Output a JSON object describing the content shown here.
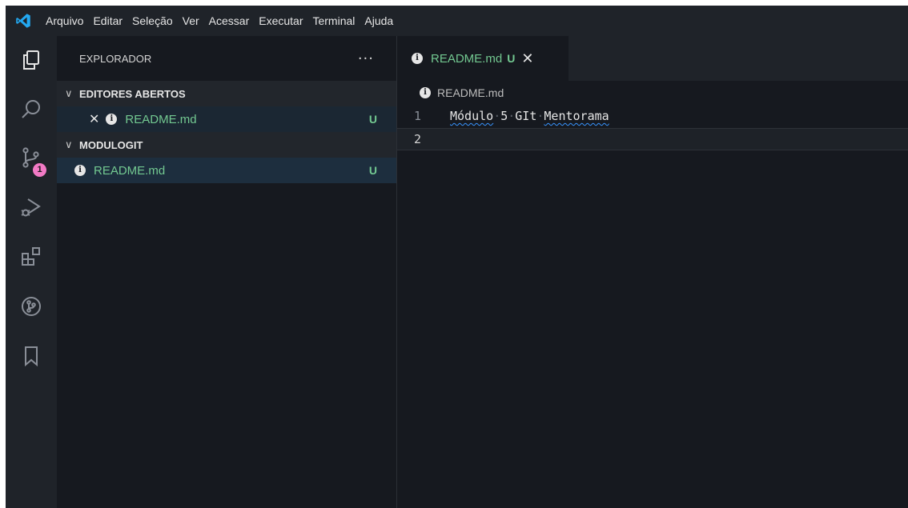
{
  "menu": {
    "items": [
      "Arquivo",
      "Editar",
      "Seleção",
      "Ver",
      "Acessar",
      "Executar",
      "Terminal",
      "Ajuda"
    ]
  },
  "activity_bar": {
    "icons": [
      "explorer-icon",
      "search-icon",
      "source-control-icon",
      "run-debug-icon",
      "extensions-icon",
      "git-graph-icon",
      "bookmarks-icon"
    ],
    "scm_badge": "1"
  },
  "sidebar": {
    "title": "EXPLORADOR",
    "more_label": "···",
    "open_editors": {
      "title": "EDITORES ABERTOS",
      "items": [
        {
          "name": "README.md",
          "status": "U"
        }
      ]
    },
    "folder": {
      "title": "MODULOGIT",
      "items": [
        {
          "name": "README.md",
          "status": "U"
        }
      ]
    }
  },
  "editor": {
    "tab": {
      "label": "README.md",
      "status": "U"
    },
    "breadcrumb": "README.md",
    "lines": [
      {
        "number": "1",
        "words": [
          "Módulo",
          "5",
          "GIt",
          "Mentorama"
        ]
      },
      {
        "number": "2",
        "words": []
      }
    ]
  },
  "colors": {
    "accent_file": "#73c991",
    "badge": "#f27ac5",
    "background": "#16191f",
    "chrome": "#1f2329",
    "logo": "#23a9f2"
  }
}
